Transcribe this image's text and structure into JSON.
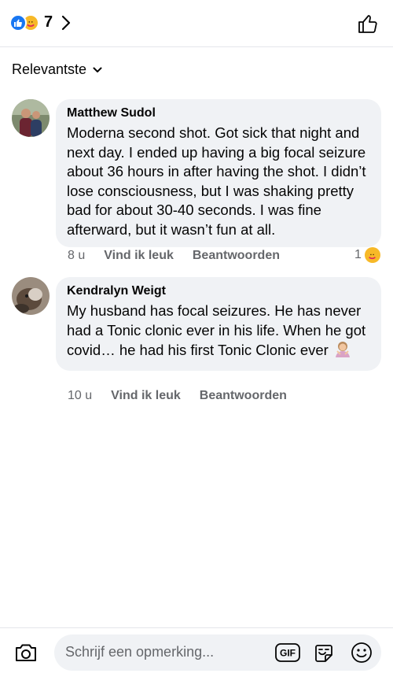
{
  "header": {
    "reaction_count": "7",
    "reactions": [
      "like-reaction",
      "care-reaction"
    ]
  },
  "sort": {
    "label": "Relevantste"
  },
  "comments": [
    {
      "author": "Matthew Sudol",
      "text": "Moderna second shot. Got sick that night and next day. I ended up having a big focal seizure about 36 hours in after having the shot. I didn’t lose consciousness, but I was shaking pretty bad for about 30-40 seconds. I was fine afterward, but it wasn’t fun at all.",
      "time": "8 u",
      "like_label": "Vind ik leuk",
      "reply_label": "Beantwoorden",
      "reaction_count": "1"
    },
    {
      "author": "Kendralyn Weigt",
      "text": "My husband has focal seizures. He has never had a Tonic clonic ever in his life. When he got covid… he had his first Tonic Clonic ever",
      "time": "10 u",
      "like_label": "Vind ik leuk",
      "reply_label": "Beantwoorden"
    }
  ],
  "composer": {
    "placeholder": "Schrijf een opmerking...",
    "gif_label": "GIF"
  },
  "colors": {
    "accent": "#1877f2",
    "bubble": "#f0f2f5",
    "secondary_text": "#65676b",
    "care_yellow": "#f7b928"
  }
}
